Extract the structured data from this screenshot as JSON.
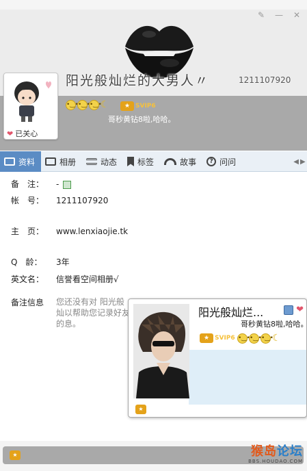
{
  "header": {
    "nickname": "阳光般灿烂的大男人〃",
    "qq_number": "1211107920",
    "signature": "哥秒黄钻8啦,哈哈。",
    "vip_label": "SVIP6",
    "care_label": "已关心",
    "window_buttons": [
      "✎",
      "—",
      "✕"
    ]
  },
  "tabs": [
    {
      "label": "资料",
      "icon": "profile-icon"
    },
    {
      "label": "相册",
      "icon": "album-icon"
    },
    {
      "label": "动态",
      "icon": "feed-icon"
    },
    {
      "label": "标签",
      "icon": "tag-icon"
    },
    {
      "label": "故事",
      "icon": "story-icon"
    },
    {
      "label": "问问",
      "icon": "question-icon"
    }
  ],
  "profile": {
    "remark_label": "备　注：",
    "remark_value": "-",
    "account_label": "帐　号：",
    "account_value": "1211107920",
    "homepage_label": "主　页：",
    "homepage_value": "www.lenxiaojie.tk",
    "qage_label": "Q　龄：",
    "qage_value": "3年",
    "english_label": "英文名：",
    "english_value": "信誉看空间相册√",
    "notes_label": "备注信息",
    "notes_text": "您还没有对 阳光般灿以帮助您记录好友的息。"
  },
  "hovercard": {
    "name": "阳光般灿烂...",
    "signature": "哥秒黄钻8啦,哈哈。",
    "vip_label": "SVIP6"
  },
  "watermark": {
    "main_a": "猴岛",
    "main_b": "论坛",
    "sub": "BBS.HOUDAO.COM"
  },
  "colors": {
    "active_tab": "#5b8cc4",
    "header_band": "#a9a9a9",
    "vip": "#e4a21a"
  }
}
